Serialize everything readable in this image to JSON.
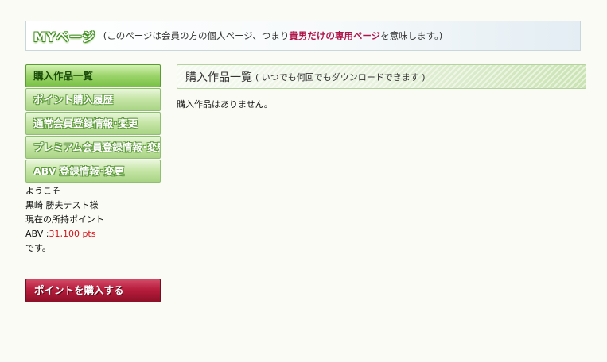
{
  "banner": {
    "logo_text": "MYページ",
    "desc_pre": "(このページは会員の方の個人ページ、つまり",
    "desc_highlight": "貴男だけの専用ページ",
    "desc_post": "を意味します。)"
  },
  "menu": {
    "items": [
      {
        "label": "購入作品一覧"
      },
      {
        "label": "ポイント購入履歴"
      },
      {
        "label": "通常会員登録情報･変更"
      },
      {
        "label": "プレミアム会員登録情報･変更"
      },
      {
        "label": "ABV 登録情報･変更"
      }
    ]
  },
  "welcome": {
    "greeting": "ようこそ",
    "user_name": "黒崎 勝夫テスト様",
    "points_label": "現在の所持ポイント",
    "points_prefix": "ABV :",
    "points_value": "31,100 pts",
    "closing": "です。"
  },
  "buy_button": {
    "label": "ポイントを購入する"
  },
  "main": {
    "title": "購入作品一覧",
    "subtitle": "( いつでも何回でもダウンロードできます )",
    "empty_message": "購入作品はありません。"
  },
  "colors": {
    "accent_green": "#79c146",
    "highlight_red": "#b0154a",
    "points_red": "#d3131a",
    "buy_button": "#b81d3d"
  }
}
